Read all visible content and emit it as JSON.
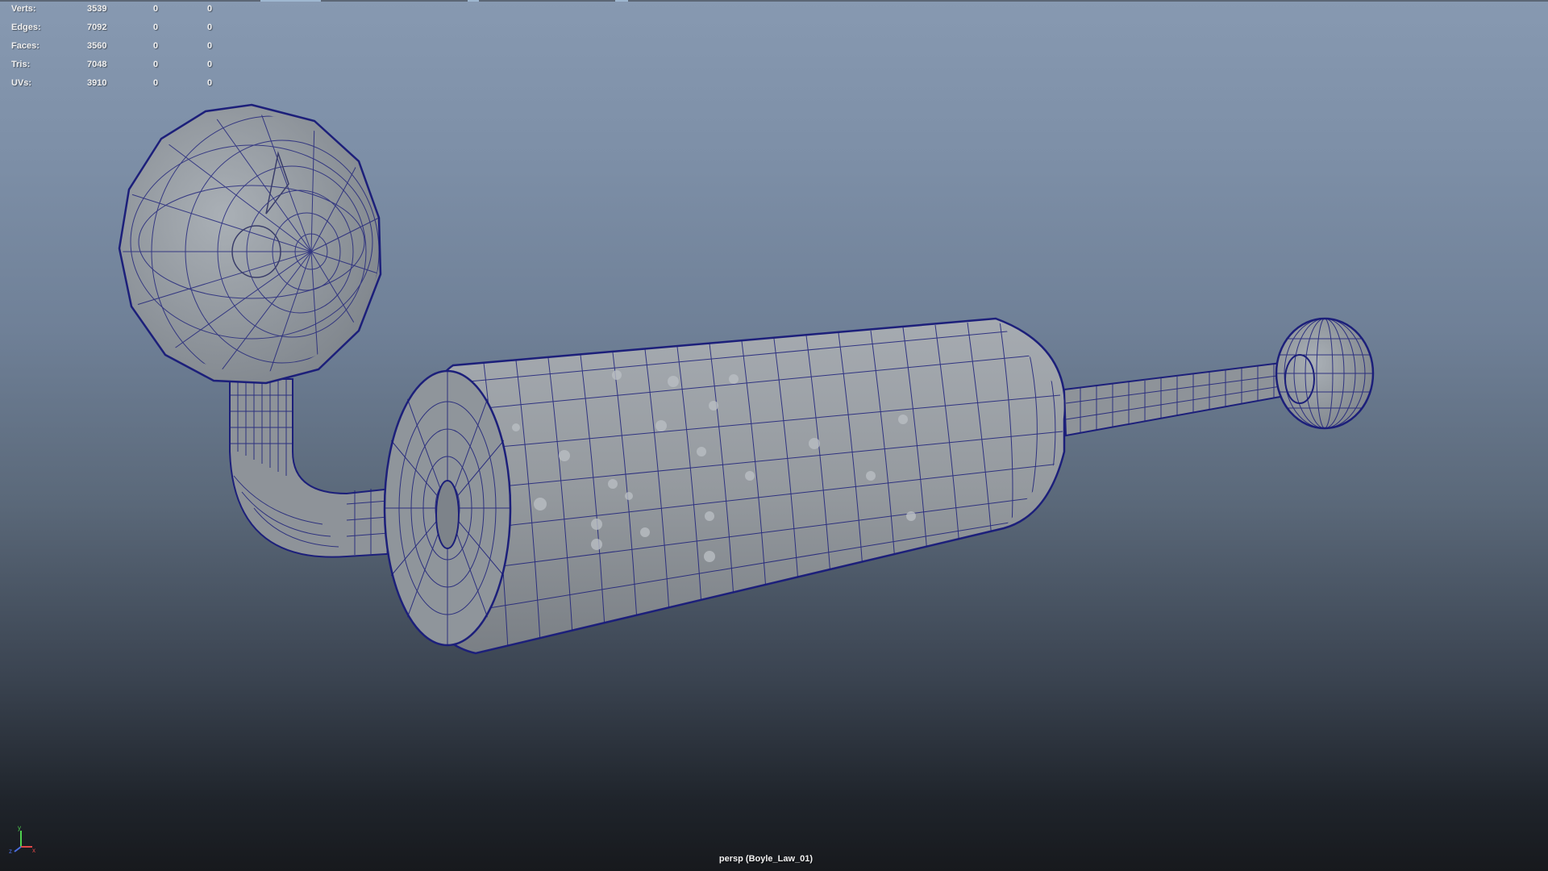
{
  "viewport": {
    "hud": {
      "rows": [
        {
          "label": "Verts:",
          "values": [
            "3539",
            "0",
            "0"
          ]
        },
        {
          "label": "Edges:",
          "values": [
            "7092",
            "0",
            "0"
          ]
        },
        {
          "label": "Faces:",
          "values": [
            "3560",
            "0",
            "0"
          ]
        },
        {
          "label": "Tris:",
          "values": [
            "7048",
            "0",
            "0"
          ]
        },
        {
          "label": "UVs:",
          "values": [
            "3910",
            "0",
            "0"
          ]
        }
      ]
    },
    "camera_label": "persp (Boyle_Law_01)",
    "axis_gizmo": {
      "x": "x",
      "y": "y",
      "z": "z"
    },
    "wire_color": "#1c1f7a",
    "mesh_color": "#8f959c",
    "background_top": "#8799b1",
    "background_bottom": "#17191d"
  }
}
